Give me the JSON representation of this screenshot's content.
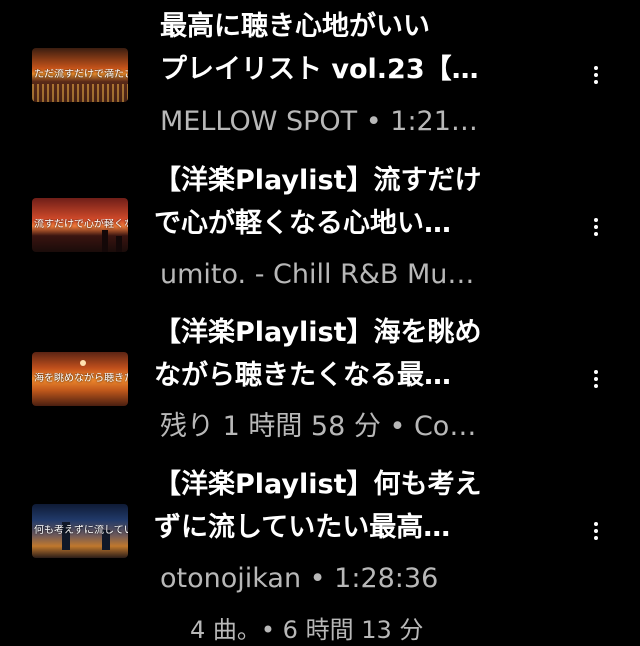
{
  "items": [
    {
      "thumbnail_caption": "ただ流すだけで満たされ",
      "title_line1": "最高に聴き心地がいい",
      "title_line2": "プレイリスト vol.23【…",
      "meta": "MELLOW SPOT • 1:21…"
    },
    {
      "thumbnail_caption": "流すだけで心が軽くなる",
      "title_line1": "【洋楽Playlist】流すだけ",
      "title_line2": "で心が軽くなる心地い…",
      "meta": "umito. - Chill R&B Mu…"
    },
    {
      "thumbnail_caption": "海を眺めながら聴きたくなる",
      "title_line1": "【洋楽Playlist】海を眺め",
      "title_line2": "ながら聴きたくなる最…",
      "meta": "残り 1 時間 58 分 • Co…"
    },
    {
      "thumbnail_caption": "何も考えずに流していたい",
      "title_line1": "【洋楽Playlist】何も考え",
      "title_line2": "ずに流していたい最高…",
      "meta": "otonojikan • 1:28:36"
    }
  ],
  "footer": {
    "text": "4 曲。• 6 時間 13 分"
  },
  "icons": {
    "more": "more-vert-icon"
  }
}
